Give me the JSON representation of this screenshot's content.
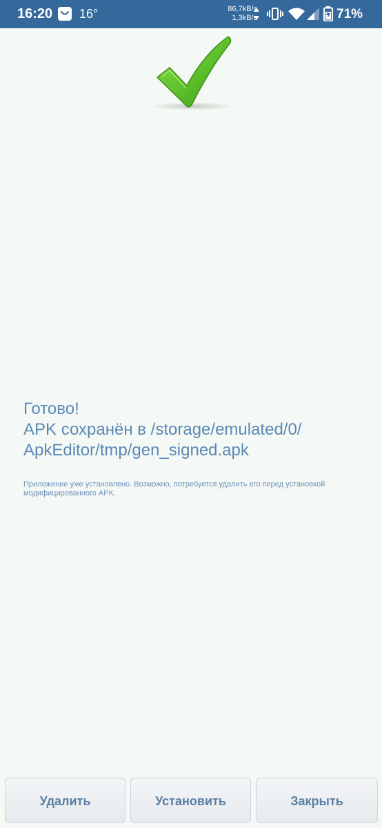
{
  "status_bar": {
    "time": "16:20",
    "temperature": "16°",
    "speed_down": "86,7kB/s",
    "speed_up": "1,3kB/s",
    "battery": "71%",
    "background_color": "#35689b",
    "icons": [
      "shop-icon",
      "vibrate-icon",
      "wifi-icon",
      "signal-icon",
      "battery-icon"
    ]
  },
  "result": {
    "icon": "checkmark-icon",
    "icon_color": "#5cbf2a",
    "title": "Готово!",
    "line2": "APK сохранён в /storage/emulated/0/",
    "line3": "ApkEditor/tmp/gen_signed.apk",
    "note": "Приложение уже установлено. Возможно, потребуется удалить его перед установкой модифицированного APK.",
    "text_color": "#5b88b5"
  },
  "buttons": {
    "delete": "Удалить",
    "install": "Установить",
    "close": "Закрыть"
  }
}
